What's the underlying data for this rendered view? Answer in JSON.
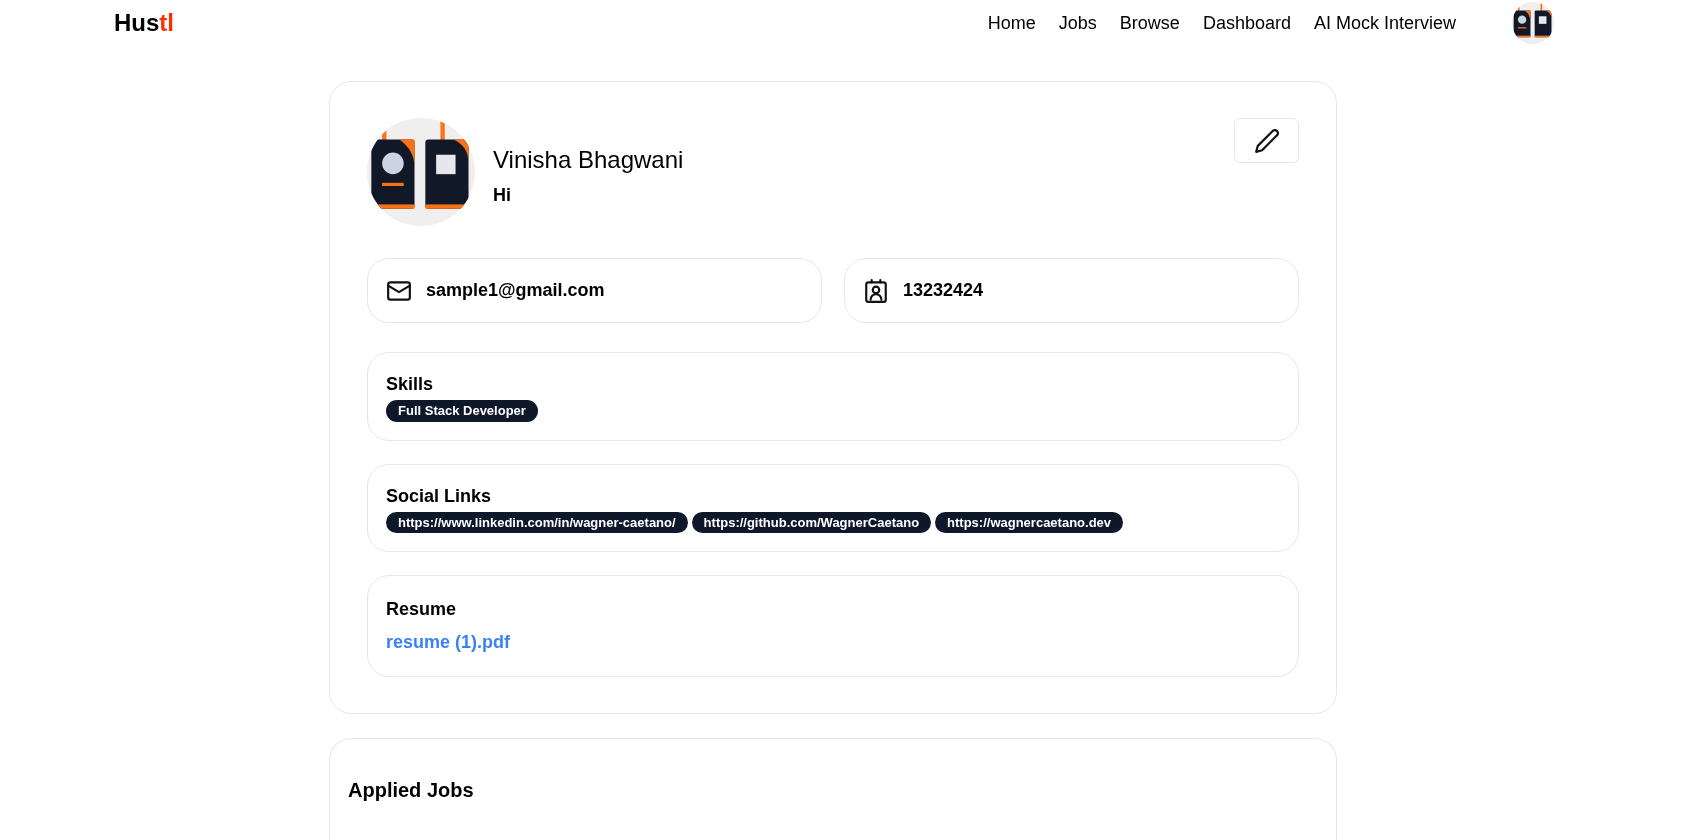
{
  "logo": {
    "main": "Hus",
    "accent": "tl"
  },
  "nav": [
    "Home",
    "Jobs",
    "Browse",
    "Dashboard",
    "AI Mock Interview"
  ],
  "profile": {
    "name": "Vinisha Bhagwani",
    "bio": "Hi",
    "contacts": [
      {
        "kind": "email",
        "value": "sample1@gmail.com"
      },
      {
        "kind": "phone",
        "value": "13232424"
      }
    ],
    "skills": {
      "title": "Skills",
      "tags": [
        "Full Stack Developer"
      ]
    },
    "social_links": {
      "title": "Social Links",
      "tags": [
        "https://www.linkedin.com/in/wagner-caetano/",
        "https://github.com/WagnerCaetano",
        "https://wagnercaetano.dev"
      ]
    },
    "resume": {
      "title": "Resume",
      "file": "resume (1).pdf"
    }
  },
  "applied_jobs": {
    "title": "Applied Jobs"
  }
}
